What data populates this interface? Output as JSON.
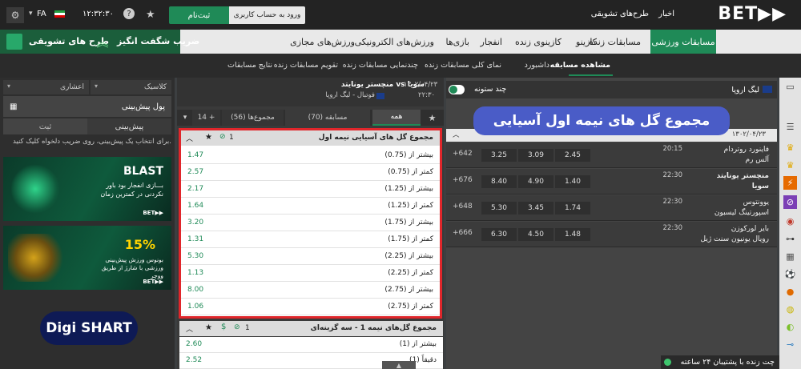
{
  "header": {
    "logo": "BET▶▶",
    "links": [
      "اخبار",
      "طرح‌های تشویقی"
    ],
    "register": "ثبت‌نام",
    "login": "ورود به حساب کاربری",
    "clock": "۱۲:۳۲:۳۰",
    "lang": "FA"
  },
  "nav": {
    "items": [
      "مسابقات ورزشی",
      "مسابقات زنده",
      "کازینو",
      "کازینوی زنده",
      "انفجار",
      "بازی‌ها",
      "ورزش‌های الکترونیکی",
      "ورزش‌های مجازی"
    ],
    "promo_right": "ضریب شگفت انگیز",
    "promo_left": "طرح های تشویقی"
  },
  "subnav": [
    "مشاهده مسابقه",
    "داشبورد",
    "نمای کلی مسابقات زنده",
    "چندنمایی مسابقات زنده",
    "تقویم مسابقات زنده",
    "نتایج مسابقات"
  ],
  "left": {
    "sel_classic": "کلاسیک",
    "sel_decimal": "اعشاری",
    "calc": "پول پیش‌بینی",
    "tab_betslip": "ثبت",
    "tab_preview": "پیش‌بینی",
    "hint": "برای انتخاب یک پیش‌بینی، روی ضریب دلخواه کلیک کنید.",
    "banner1_title": "BLAST",
    "banner1_text": "بـــازی انفجار بود باور نکردنی در کمترین زمان",
    "banner2_pct": "15%",
    "banner2_text": "بونوس ورزش پیش‌بینی ورزشی با شارژ از طریق ووچر",
    "brand": "BET▶▶",
    "digi": "Digi SHART"
  },
  "match": {
    "teams": "منچستر یونایتد  vs  سویا",
    "date": "۱۳۰۲/۰۴/۲۳",
    "time": "۲۲:۳۰",
    "league": "فوتبال - لیگ اروپا",
    "tabs": [
      "همه",
      "مسابقه (70)",
      "مجموع‌ها (56)",
      "14 +"
    ]
  },
  "market1": {
    "title": "مجموع گل های آسیایی نیمه اول",
    "count": "1",
    "rows": [
      {
        "label": "بیشتر از (0.75)",
        "odd": "1.47"
      },
      {
        "label": "کمتر از (0.75)",
        "odd": "2.57"
      },
      {
        "label": "بیشتر از (1.25)",
        "odd": "2.17"
      },
      {
        "label": "کمتر از (1.25)",
        "odd": "1.64"
      },
      {
        "label": "بیشتر از (1.75)",
        "odd": "3.20"
      },
      {
        "label": "کمتر از (1.75)",
        "odd": "1.31"
      },
      {
        "label": "بیشتر از (2.25)",
        "odd": "5.30"
      },
      {
        "label": "کمتر از (2.25)",
        "odd": "1.13"
      },
      {
        "label": "بیشتر از (2.75)",
        "odd": "8.00"
      },
      {
        "label": "کمتر از (2.75)",
        "odd": "1.06"
      }
    ]
  },
  "market2": {
    "title": "مجموع گل‌های نیمه 1 - سه گزینه‌ای",
    "count": "1",
    "rows": [
      {
        "label": "بیشتر از (1)",
        "odd": "2.60"
      },
      {
        "label": "دقیقاً (1)",
        "odd": "2.52"
      }
    ]
  },
  "right": {
    "league": "لیگ اروپا",
    "multi_col": "چند ستونه",
    "overlay": "مجموع گل های نیمه اول آسیایی",
    "date": "۱۳۰۲/۰۴/۲۳",
    "matches": [
      {
        "home": "فاینورد روتردام",
        "away": "آلس رم",
        "time": "20:15",
        "o1": "2.45",
        "ox": "3.09",
        "o2": "3.25",
        "more": "+642"
      },
      {
        "home": "منچستر یونایتد",
        "away": "سویا",
        "time": "22:30",
        "o1": "1.40",
        "ox": "4.90",
        "o2": "8.40",
        "more": "+676"
      },
      {
        "home": "یوونتوس",
        "away": "اسپورتینگ لیسبون",
        "time": "22:30",
        "o1": "1.74",
        "ox": "3.45",
        "o2": "5.30",
        "more": "+648"
      },
      {
        "home": "بایر لورکوزن",
        "away": "رویال یونیون سنت ژیل",
        "time": "22:30",
        "o1": "1.48",
        "ox": "4.50",
        "o2": "6.30",
        "more": "+666"
      }
    ],
    "chat": "چت زنده با پشتیبان ۲۴ ساعته"
  },
  "colors": {
    "accent": "#1f8a57",
    "highlight": "#e0262b",
    "overlay": "#4a5cc7"
  }
}
